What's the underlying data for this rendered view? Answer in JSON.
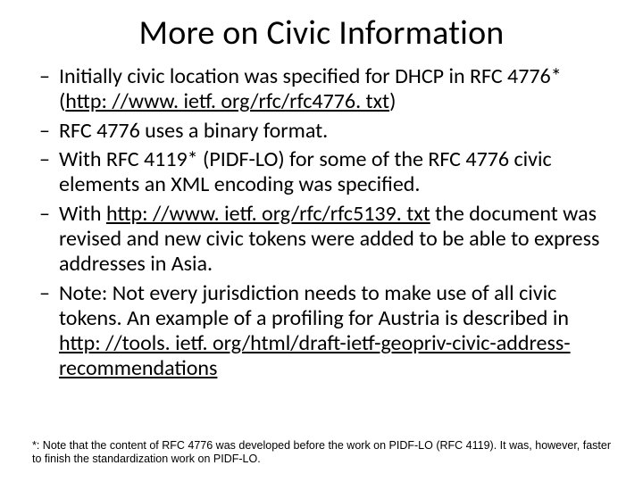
{
  "title": "More on Civic Information",
  "bullets": {
    "b0_pre": "Initially civic location was specified for DHCP in RFC 4776* (",
    "b0_link": "http: //www. ietf. org/rfc/rfc4776. txt",
    "b0_post": ")",
    "b1": "RFC 4776 uses a binary format.",
    "b2": "With RFC 4119* (PIDF-LO) for some of the RFC 4776 civic elements an XML encoding was specified.",
    "b3_pre": "With ",
    "b3_link": "http: //www. ietf. org/rfc/rfc5139. txt",
    "b3_post": " the document was revised and new civic tokens were added to be able to express addresses in Asia.",
    "b4_pre": "Note: Not every jurisdiction needs to make use of all civic tokens. An example of a profiling for Austria is described in ",
    "b4_link": "http: //tools. ietf. org/html/draft-ietf-geopriv-civic-address-recommendations"
  },
  "footnote": "*: Note that the content of RFC 4776 was developed before the work on PIDF-LO (RFC 4119). It was, however, faster to finish the standardization work on PIDF-LO."
}
